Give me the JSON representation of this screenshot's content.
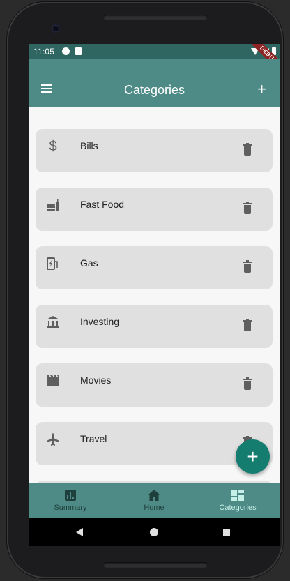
{
  "status_bar": {
    "time": "11:05",
    "debug_label": "DEBUG"
  },
  "app_bar": {
    "title": "Categories"
  },
  "categories": [
    {
      "label": "Bills",
      "icon": "dollar-icon"
    },
    {
      "label": "Fast Food",
      "icon": "fastfood-icon"
    },
    {
      "label": "Gas",
      "icon": "ev-station-icon"
    },
    {
      "label": "Investing",
      "icon": "bank-icon"
    },
    {
      "label": "Movies",
      "icon": "movie-icon"
    },
    {
      "label": "Travel",
      "icon": "airplane-icon"
    }
  ],
  "bottom_nav": {
    "items": [
      {
        "label": "Summary",
        "icon": "summary-chart-icon"
      },
      {
        "label": "Home",
        "icon": "home-icon"
      },
      {
        "label": "Categories",
        "icon": "dashboard-icon"
      }
    ],
    "active": "Categories"
  },
  "colors": {
    "app_bar": "#4e8b86",
    "status_bar": "#2f6662",
    "card_bg": "#e0e0e0",
    "fab": "#157d70",
    "icon_gray": "#5f5f5f"
  }
}
